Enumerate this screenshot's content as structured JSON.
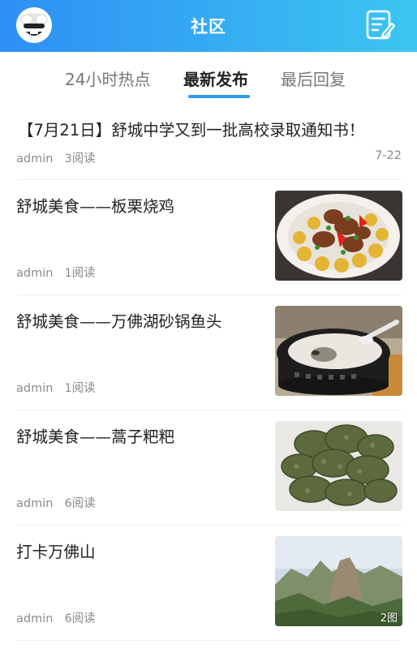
{
  "header": {
    "title": "社区",
    "avatar_icon": "user-avatar-icon",
    "edit_icon": "edit-note-icon",
    "colors": {
      "gradient_start": "#2e8ff5",
      "gradient_end": "#3cc6f0"
    }
  },
  "tabs": [
    {
      "label": "24小时热点",
      "active": false
    },
    {
      "label": "最新发布",
      "active": true
    },
    {
      "label": "最后回复",
      "active": false
    }
  ],
  "posts": [
    {
      "title": "【7月21日】舒城中学又到一批高校录取通知书！",
      "author": "admin",
      "reads": "3阅读",
      "date": "7-22"
    },
    {
      "title": "舒城美食——板栗烧鸡",
      "author": "admin",
      "reads": "1阅读",
      "image": "braised-chicken-photo"
    },
    {
      "title": "舒城美食——万佛湖砂锅鱼头",
      "author": "admin",
      "reads": "1阅读",
      "image": "fish-head-casserole-photo"
    },
    {
      "title": "舒城美食——蒿子粑粑",
      "author": "admin",
      "reads": "6阅读",
      "image": "herb-pancakes-photo"
    },
    {
      "title": "打卡万佛山",
      "author": "admin",
      "reads": "6阅读",
      "image": "mountain-photo",
      "image_count": "2图"
    }
  ]
}
